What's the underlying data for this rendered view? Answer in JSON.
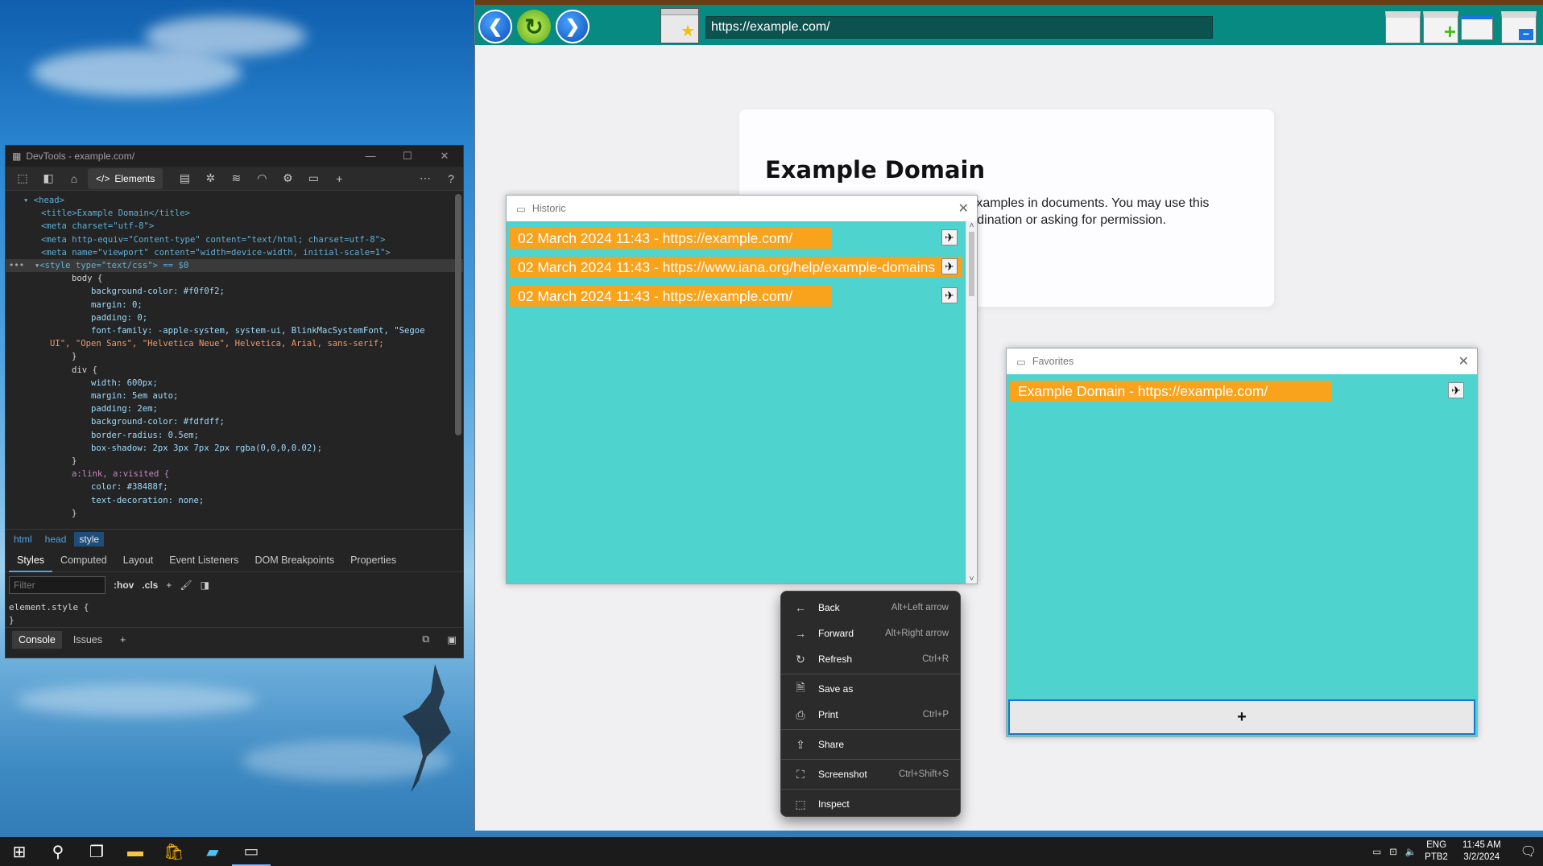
{
  "devtools": {
    "title": "DevTools - example.com/",
    "elements_tab": "Elements",
    "code_lines": [
      "<head>",
      "<title>Example Domain</title>",
      "<meta charset=\"utf-8\">",
      "<meta http-equiv=\"Content-type\" content=\"text/html; charset=utf-8\">",
      "<meta name=\"viewport\" content=\"width=device-width, initial-scale=1\">",
      "<style type=\"text/css\"> == $0",
      "body {",
      "background-color: #f0f0f2;",
      "margin: 0;",
      "padding: 0;",
      "font-family: -apple-system, system-ui, BlinkMacSystemFont, \"Segoe",
      "UI\", \"Open Sans\", \"Helvetica Neue\", Helvetica, Arial, sans-serif;",
      "",
      "}",
      "div {",
      "width: 600px;",
      "margin: 5em auto;",
      "padding: 2em;",
      "background-color: #fdfdff;",
      "border-radius: 0.5em;",
      "box-shadow: 2px 3px 7px 2px rgba(0,0,0,0.02);",
      "}",
      "a:link, a:visited {",
      "color: #38488f;",
      "text-decoration: none;",
      "}"
    ],
    "breadcrumbs": [
      "html",
      "head",
      "style"
    ],
    "style_tabs": [
      "Styles",
      "Computed",
      "Layout",
      "Event Listeners",
      "DOM Breakpoints",
      "Properties"
    ],
    "filter_placeholder": "Filter",
    "hov": ":hov",
    "cls": ".cls",
    "element_style": "element.style {",
    "element_style_close": "}",
    "bottom_tabs": [
      "Console",
      "Issues"
    ]
  },
  "browser": {
    "url": "https://example.com/",
    "page": {
      "heading": "Example Domain",
      "paragraph": "This domain is for use in illustrative examples in documents. You may use this domain in literature without prior coordination or asking for permission."
    }
  },
  "historic": {
    "title": "Historic",
    "items": [
      "02 March 2024 11:43 - https://example.com/",
      "02 March 2024 11:43 - https://www.iana.org/help/example-domains",
      "02 March 2024 11:43 - https://example.com/"
    ]
  },
  "favorites": {
    "title": "Favorites",
    "items": [
      "Example Domain - https://example.com/"
    ],
    "add_label": "+"
  },
  "context_menu": {
    "items": [
      {
        "label": "Back",
        "shortcut": "Alt+Left arrow",
        "icon": "arrow-left-icon"
      },
      {
        "label": "Forward",
        "shortcut": "Alt+Right arrow",
        "icon": "arrow-right-icon"
      },
      {
        "label": "Refresh",
        "shortcut": "Ctrl+R",
        "icon": "refresh-icon"
      },
      {
        "label": "Save as",
        "shortcut": "",
        "icon": "save-icon"
      },
      {
        "label": "Print",
        "shortcut": "Ctrl+P",
        "icon": "print-icon"
      },
      {
        "label": "Share",
        "shortcut": "",
        "icon": "share-icon"
      },
      {
        "label": "Screenshot",
        "shortcut": "Ctrl+Shift+S",
        "icon": "screenshot-icon"
      },
      {
        "label": "Inspect",
        "shortcut": "",
        "icon": "inspect-icon"
      }
    ]
  },
  "taskbar": {
    "lang": "ENG",
    "layout": "PTB2",
    "time": "11:45 AM",
    "date": "3/2/2024"
  },
  "colors": {
    "browser_toolbar": "#078a82",
    "panel_body": "#4fd3ce",
    "list_item": "#f9a21c"
  }
}
